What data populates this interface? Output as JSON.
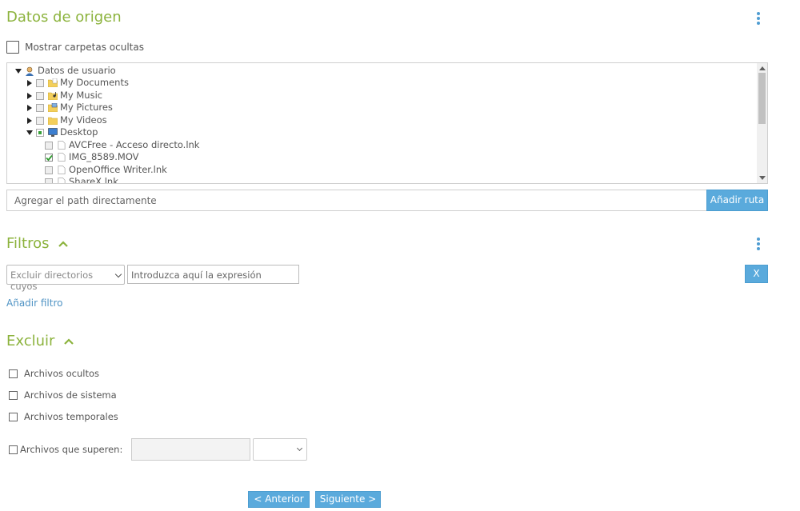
{
  "colors": {
    "section_title": "#8cb33d",
    "accent_blue": "#5aaadc",
    "link": "#4f93c4"
  },
  "source": {
    "title": "Datos de origen",
    "menu_icon": "kebab-menu-icon",
    "show_hidden_label": "Mostrar carpetas ocultas",
    "tree": {
      "root": "Datos de usuario",
      "items": [
        {
          "label": "My Documents",
          "icon": "documents-folder-icon"
        },
        {
          "label": "My Music",
          "icon": "music-folder-icon"
        },
        {
          "label": "My Pictures",
          "icon": "pictures-folder-icon"
        },
        {
          "label": "My Videos",
          "icon": "videos-folder-icon"
        },
        {
          "label": "Desktop",
          "icon": "desktop-icon"
        }
      ],
      "desktop_files": [
        {
          "label": "AVCFree - Acceso directo.lnk",
          "checked": false
        },
        {
          "label": "IMG_8589.MOV",
          "checked": true
        },
        {
          "label": "OpenOffice Writer.lnk",
          "checked": false
        },
        {
          "label": "ShareX.lnk",
          "checked": false
        }
      ]
    },
    "path_placeholder": "Agregar el path directamente",
    "add_path_button": "Añadir ruta"
  },
  "filters": {
    "title": "Filtros",
    "select_value": "Excluir directorios cuyos",
    "expr_placeholder": "Introduzca aquí la expresión",
    "remove_button": "X",
    "add_filter_link": "Añadir filtro"
  },
  "exclude": {
    "title": "Excluir",
    "hidden_files": "Archivos ocultos",
    "system_files": "Archivos de sistema",
    "temp_files": "Archivos temporales",
    "larger_than": "Archivos que superen:",
    "size_value": "",
    "unit_value": ""
  },
  "nav": {
    "prev": "< Anterior",
    "next": "Siguiente >"
  }
}
